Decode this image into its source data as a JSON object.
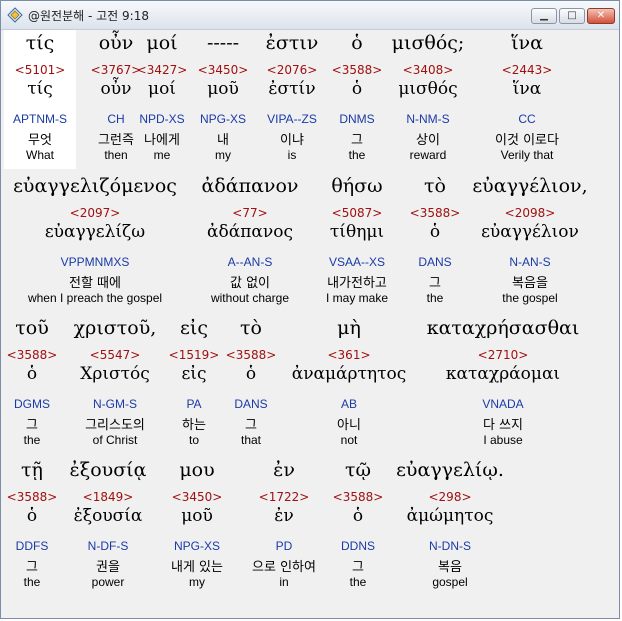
{
  "window": {
    "title": "@원전분해 - 고전 9:18",
    "min_glyph": "▁",
    "max_glyph": "□",
    "close_glyph": "✕",
    "icon": "app-diamond-icon"
  },
  "rows": [
    {
      "words": [
        {
          "greek": "τίς",
          "strong": "<5101>",
          "lemma": "τίς",
          "parse": "APTNM-S",
          "korean": "무엇",
          "english": "What"
        },
        {
          "greek": "οὖν",
          "strong": "<3767>",
          "lemma": "οὖν",
          "parse": "CH",
          "korean": "그런즉",
          "english": "then"
        },
        {
          "greek": "μοί",
          "strong": "<3427>",
          "lemma": "μοί",
          "parse": "NPD-XS",
          "korean": "나에게",
          "english": "me"
        },
        {
          "greek": "-----",
          "strong": "<3450>",
          "lemma": "μοῦ",
          "parse": "NPG-XS",
          "korean": "내",
          "english": "my"
        },
        {
          "greek": "ἐστιν",
          "strong": "<2076>",
          "lemma": "ἐστίν",
          "parse": "VIPA--ZS",
          "korean": "이냐",
          "english": "is"
        },
        {
          "greek": "ὁ",
          "strong": "<3588>",
          "lemma": "ὁ",
          "parse": "DNMS",
          "korean": "그",
          "english": "the"
        },
        {
          "greek": "μισθός;",
          "strong": "<3408>",
          "lemma": "μισθός",
          "parse": "N-NM-S",
          "korean": "상이",
          "english": "reward"
        },
        {
          "greek": "ἵνα",
          "strong": "<2443>",
          "lemma": "ἵνα",
          "parse": "CC",
          "korean": "이것 이로다",
          "english": "Verily that"
        }
      ]
    },
    {
      "words": [
        {
          "greek": "εὐαγγελιζόμενος",
          "strong": "<2097>",
          "lemma": "εὐαγγελίζω",
          "parse": "VPPMNMXS",
          "korean": "전할 때에",
          "english": "when I preach the gospel"
        },
        {
          "greek": "ἀδάπανον",
          "strong": "<77>",
          "lemma": "ἀδάπανος",
          "parse": "A--AN-S",
          "korean": "값 없이",
          "english": "without charge"
        },
        {
          "greek": "θήσω",
          "strong": "<5087>",
          "lemma": "τίθημι",
          "parse": "VSAA--XS",
          "korean": "내가전하고",
          "english": "I may make"
        },
        {
          "greek": "τὸ",
          "strong": "<3588>",
          "lemma": "ὁ",
          "parse": "DANS",
          "korean": "그",
          "english": "the"
        },
        {
          "greek": "εὐαγγέλιον,",
          "strong": "<2098>",
          "lemma": "εὐαγγέλιον",
          "parse": "N-AN-S",
          "korean": "복음을",
          "english": "the gospel"
        }
      ]
    },
    {
      "words": [
        {
          "greek": "τοῦ",
          "strong": "<3588>",
          "lemma": "ὁ",
          "parse": "DGMS",
          "korean": "그",
          "english": "the"
        },
        {
          "greek": "χριστοῦ,",
          "strong": "<5547>",
          "lemma": "Χριστός",
          "parse": "N-GM-S",
          "korean": "그리스도의",
          "english": "of Christ"
        },
        {
          "greek": "εἰς",
          "strong": "<1519>",
          "lemma": "εἰς",
          "parse": "PA",
          "korean": "하는",
          "english": "to"
        },
        {
          "greek": "τὸ",
          "strong": "<3588>",
          "lemma": "ὁ",
          "parse": "DANS",
          "korean": "그",
          "english": "that"
        },
        {
          "greek": "μὴ",
          "strong": "<361>",
          "lemma": "ἀναμάρτητος",
          "parse": "AB",
          "korean": "아니",
          "english": "not"
        },
        {
          "greek": "καταχρήσασθαι",
          "strong": "<2710>",
          "lemma": "καταχράομαι",
          "parse": "VNADA",
          "korean": "다 쓰지",
          "english": "I abuse"
        }
      ]
    },
    {
      "words": [
        {
          "greek": "τῇ",
          "strong": "<3588>",
          "lemma": "ὁ",
          "parse": "DDFS",
          "korean": "그",
          "english": "the"
        },
        {
          "greek": "ἐξουσίᾳ",
          "strong": "<1849>",
          "lemma": "ἐξουσία",
          "parse": "N-DF-S",
          "korean": "권을",
          "english": "power"
        },
        {
          "greek": "μου",
          "strong": "<3450>",
          "lemma": "μοῦ",
          "parse": "NPG-XS",
          "korean": "내게 있는",
          "english": "my"
        },
        {
          "greek": "ἐν",
          "strong": "<1722>",
          "lemma": "ἐν",
          "parse": "PD",
          "korean": "으로 인하여",
          "english": "in"
        },
        {
          "greek": "τῷ",
          "strong": "<3588>",
          "lemma": "ὁ",
          "parse": "DDNS",
          "korean": "그",
          "english": "the"
        },
        {
          "greek": "εὐαγγελίῳ.",
          "strong": "<298>",
          "lemma": "ἀμώμητος",
          "parse": "N-DN-S",
          "korean": "복음",
          "english": "gospel"
        }
      ]
    }
  ]
}
